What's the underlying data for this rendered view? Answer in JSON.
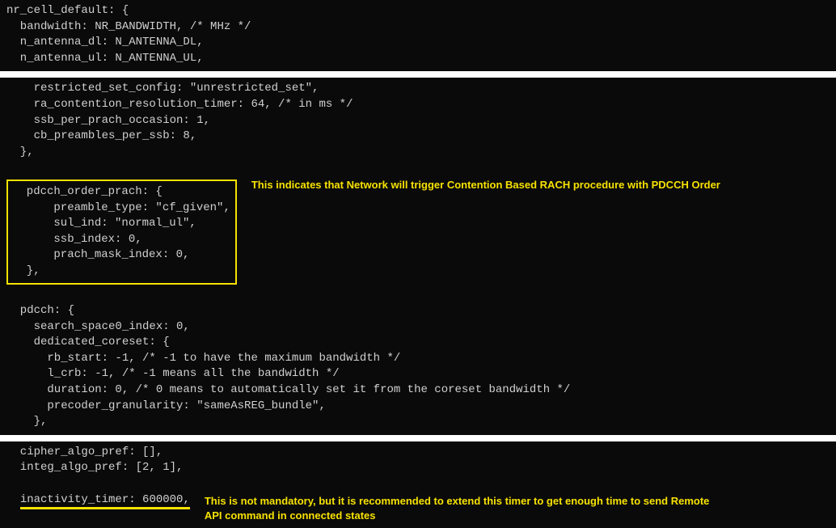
{
  "block1": {
    "l1": "nr_cell_default: {",
    "l2": "  bandwidth: NR_BANDWIDTH, /* MHz */",
    "l3": "  n_antenna_dl: N_ANTENNA_DL,",
    "l4": "  n_antenna_ul: N_ANTENNA_UL,"
  },
  "block2": {
    "l1": "    restricted_set_config: \"unrestricted_set\",",
    "l2": "    ra_contention_resolution_timer: 64, /* in ms */",
    "l3": "    ssb_per_prach_occasion: 1,",
    "l4": "    cb_preambles_per_ssb: 8,",
    "l5": "  },",
    "box_l1": "  pdcch_order_prach: {",
    "box_l2": "      preamble_type: \"cf_given\",",
    "box_l3": "      sul_ind: \"normal_ul\",",
    "box_l4": "      ssb_index: 0,",
    "box_l5": "      prach_mask_index: 0,",
    "box_l6": "  },",
    "annot1": "This indicates that Network will trigger Contention Based RACH procedure with PDCCH Order",
    "l6": "  pdcch: {",
    "l7": "    search_space0_index: 0,",
    "l8": "",
    "l9": "    dedicated_coreset: {",
    "l10": "      rb_start: -1, /* -1 to have the maximum bandwidth */",
    "l11": "      l_crb: -1, /* -1 means all the bandwidth */",
    "l12": "      duration: 0, /* 0 means to automatically set it from the coreset bandwidth */",
    "l13": "      precoder_granularity: \"sameAsREG_bundle\",",
    "l14": "    },"
  },
  "block3": {
    "l1": "  cipher_algo_pref: [],",
    "l2": "  integ_algo_pref: [2, 1],",
    "l3_pre": "  ",
    "l3_u": "inactivity_timer: 600000,",
    "annot2a": "This is not mandatory, but it is recommended to extend this timer to get enough time to send Remote",
    "annot2b": "API command in connected states"
  }
}
